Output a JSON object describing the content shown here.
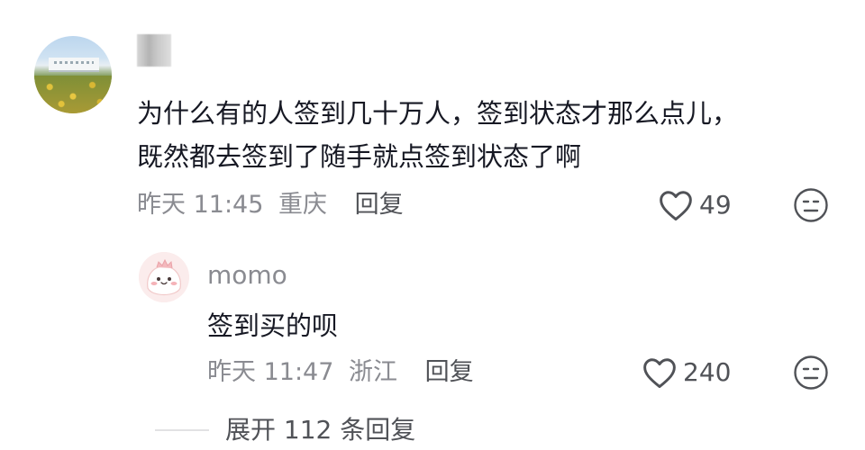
{
  "comment": {
    "text_line1": "为什么有的人签到几十万人，签到状态才那么点儿，",
    "text_line2": "既然都去签到了随手就点签到状态了啊",
    "time": "昨天 11:45",
    "location": "重庆",
    "reply_label": "回复",
    "likes": "49",
    "avatar_icon": "landscape-photo-avatar",
    "like_icon": "heart-outline-icon",
    "dislike_icon": "meh-face-icon"
  },
  "reply": {
    "username": "momo",
    "text": "签到买的呗",
    "time": "昨天 11:47",
    "location": "浙江",
    "reply_label": "回复",
    "likes": "240",
    "avatar_icon": "cute-cartoon-avatar"
  },
  "expand": {
    "label": "展开 112 条回复"
  },
  "colors": {
    "primary_text": "#161823",
    "secondary_text": "#8a8b91",
    "action_text": "#505257"
  }
}
